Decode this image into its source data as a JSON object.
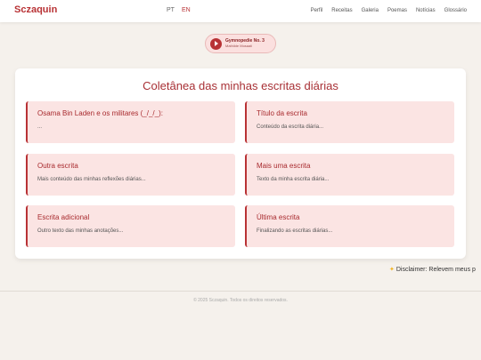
{
  "navbar": {
    "brand": "Sczaquin",
    "languages": [
      "PT",
      "EN"
    ],
    "links": [
      "Perfil",
      "Receitas",
      "Galeria",
      "Poemas",
      "Notícias",
      "Glossário"
    ]
  },
  "player": {
    "title": "Gymnopedie No. 3",
    "artist": "Mathilde Mosaali"
  },
  "main": {
    "title": "Coletânea das minhas escritas diárias",
    "entries": [
      {
        "title": "Osama Bin Laden e os militares (_/_/_):",
        "text": "..."
      },
      {
        "title": "Título da escrita",
        "text": "Conteúdo da escrita diária..."
      },
      {
        "title": "Outra escrita",
        "text": "Mais conteúdo das minhas reflexões diárias..."
      },
      {
        "title": "Mais uma escrita",
        "text": "Texto da minha escrita diária..."
      },
      {
        "title": "Escrita adicional",
        "text": "Outro texto das minhas anotações..."
      },
      {
        "title": "Última escrita",
        "text": "Finalizando as escritas diárias..."
      }
    ]
  },
  "disclaimer": "Disclaimer: Relevem meus p",
  "footer": "© 2025 Sczaquin. Todos os direitos reservados.",
  "colors": {
    "accent": "#b83235",
    "card_bg": "#fbe4e3",
    "page_bg": "#f5f1ec"
  }
}
